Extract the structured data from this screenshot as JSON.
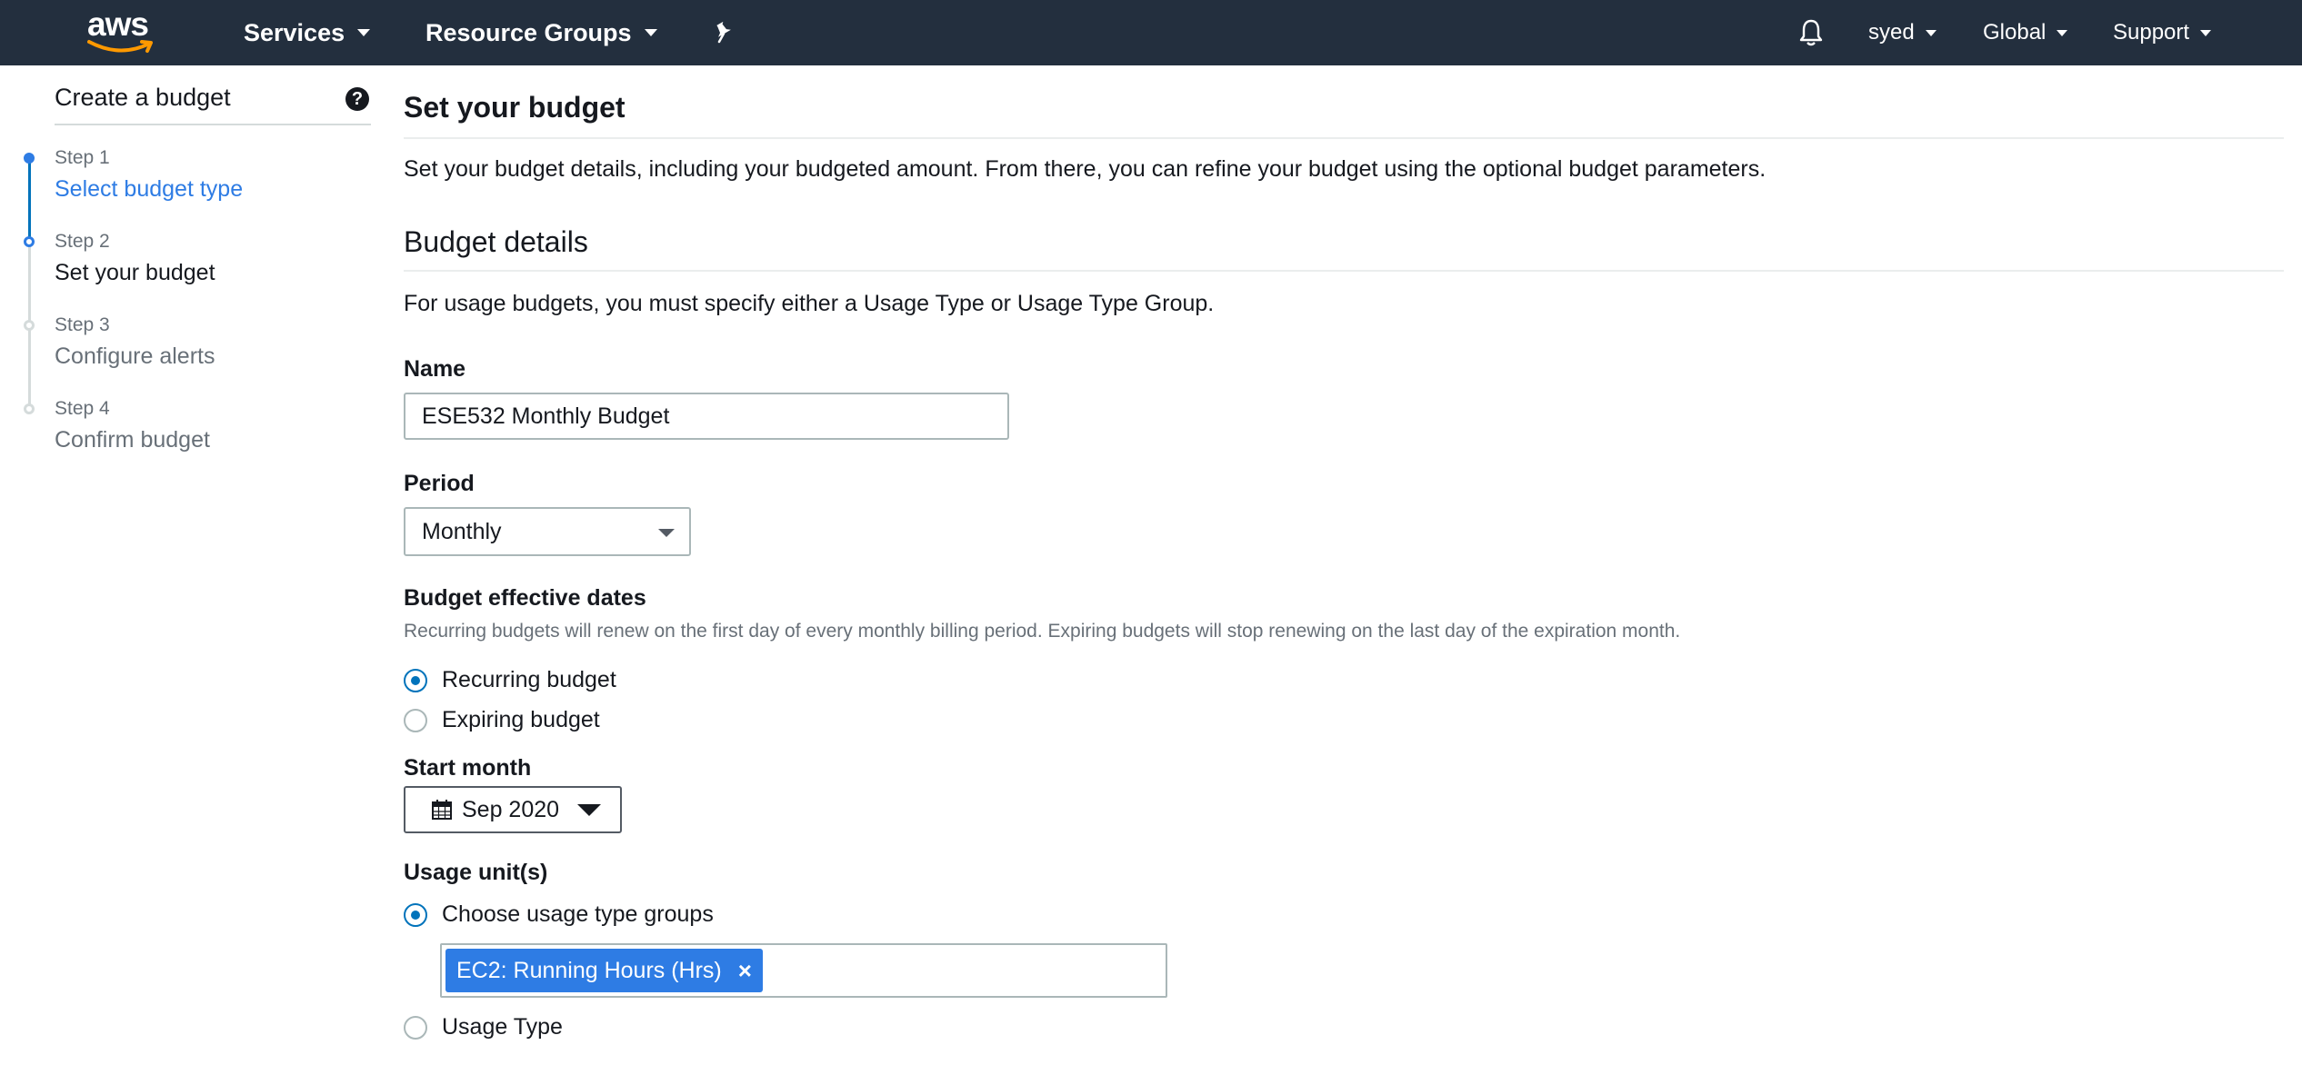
{
  "header": {
    "logo": "aws",
    "services": "Services",
    "resource_groups": "Resource Groups",
    "pin_icon": "pushpin-icon",
    "bell_icon": "bell-icon",
    "user": "syed",
    "region": "Global",
    "support": "Support"
  },
  "wizard": {
    "title": "Create a budget",
    "help_icon": "?",
    "steps": [
      {
        "num": "Step 1",
        "label": "Select budget type",
        "state": "done"
      },
      {
        "num": "Step 2",
        "label": "Set your budget",
        "state": "current"
      },
      {
        "num": "Step 3",
        "label": "Configure alerts",
        "state": "future"
      },
      {
        "num": "Step 4",
        "label": "Confirm budget",
        "state": "future"
      }
    ]
  },
  "main": {
    "title": "Set your budget",
    "intro": "Set your budget details, including your budgeted amount. From there, you can refine your budget using the optional budget parameters.",
    "details_title": "Budget details",
    "details_note": "For usage budgets, you must specify either a Usage Type or Usage Type Group.",
    "name_label": "Name",
    "name_value": "ESE532 Monthly Budget",
    "period_label": "Period",
    "period_value": "Monthly",
    "dates_label": "Budget effective dates",
    "dates_desc": "Recurring budgets will renew on the first day of every monthly billing period. Expiring budgets will stop renewing on the last day of the expiration month.",
    "recurring_label": "Recurring budget",
    "expiring_label": "Expiring budget",
    "start_month_label": "Start month",
    "start_month_value": "Sep 2020",
    "usage_units_label": "Usage unit(s)",
    "usage_groups_label": "Choose usage type groups",
    "usage_tag": "EC2: Running Hours (Hrs)",
    "usage_tag_remove": "×",
    "usage_type_label": "Usage Type"
  },
  "colors": {
    "nav_bg": "#232f3e",
    "accent": "#2e7ce4",
    "logo_smile": "#ff9900"
  }
}
